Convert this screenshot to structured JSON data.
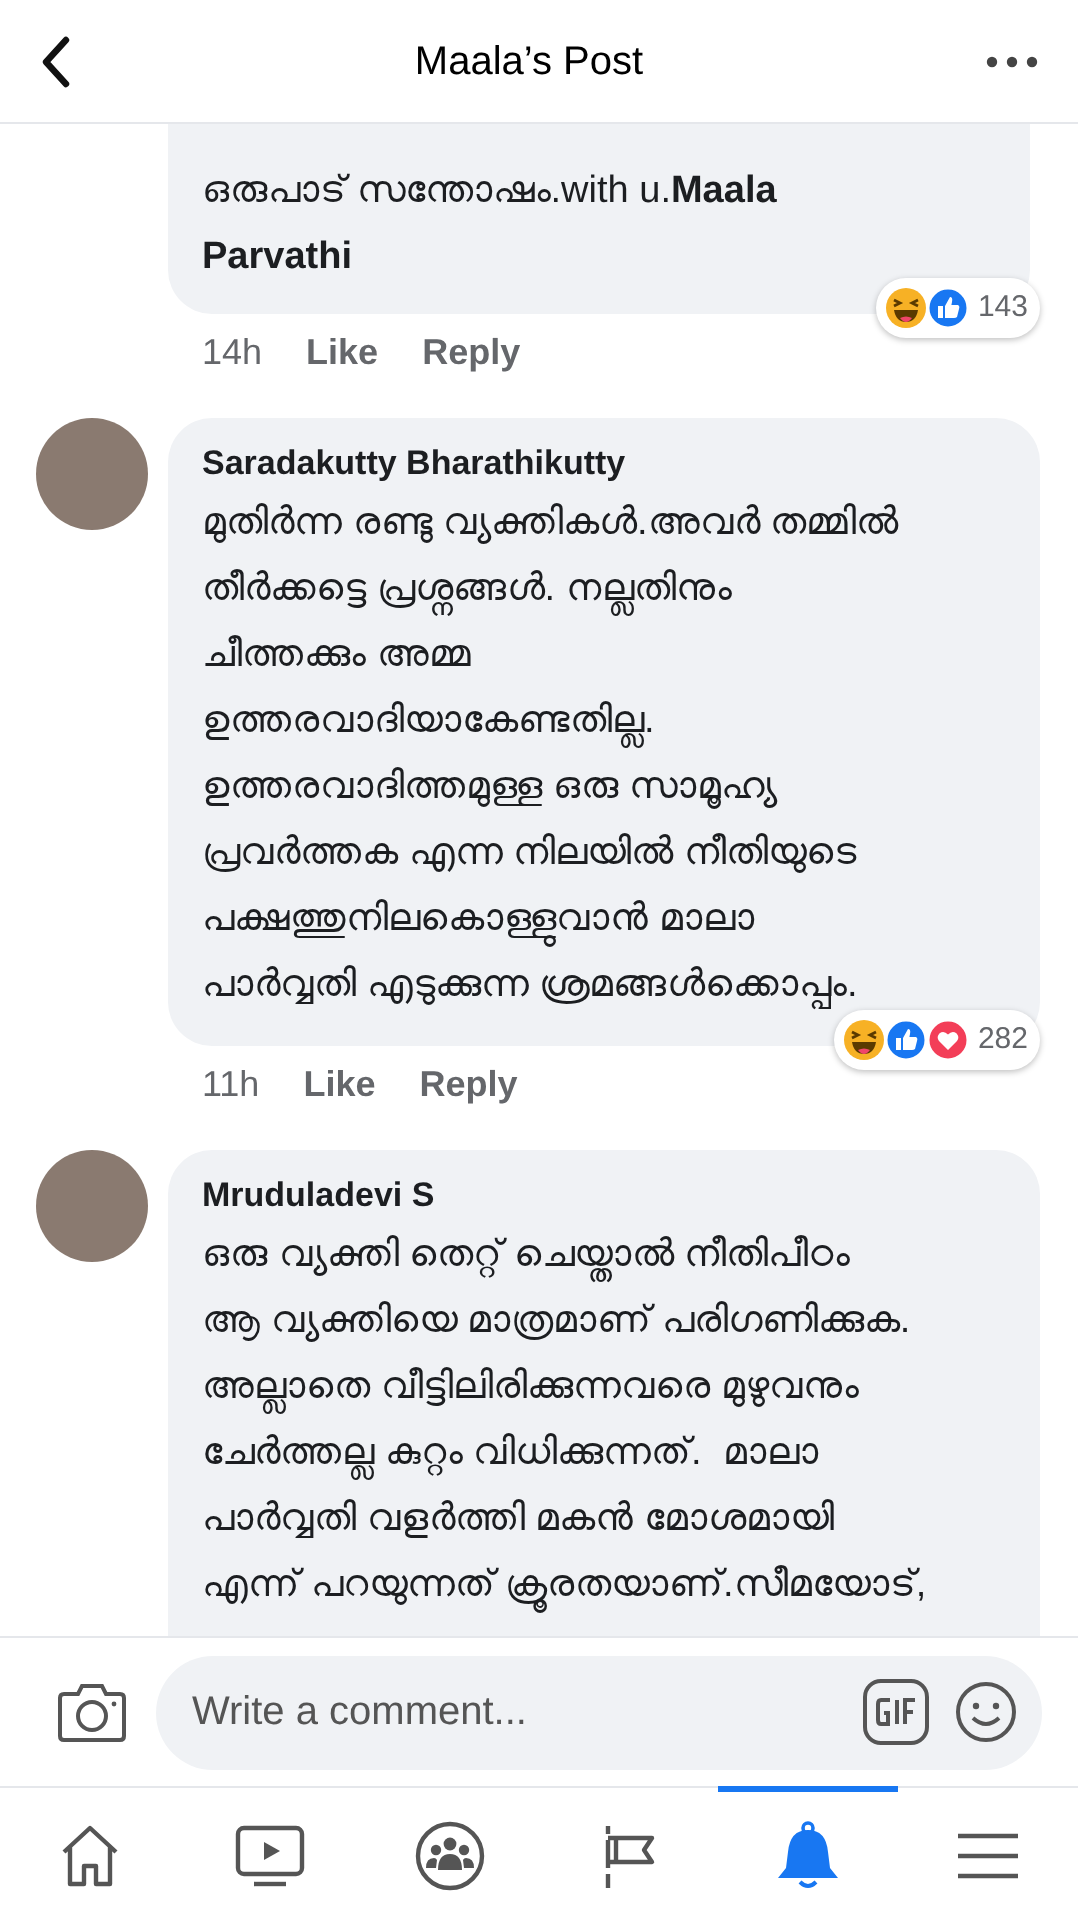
{
  "header": {
    "title": "Maala’s Post"
  },
  "comments": [
    {
      "lines": [
        "ഒരുപാട് സന്തോഷം.with u.**Maala**",
        "**Parvathi**"
      ],
      "time": "14h",
      "actions": [
        "Like",
        "Reply"
      ],
      "reactions": [
        {
          "kind": "haha"
        },
        {
          "kind": "like"
        }
      ],
      "reaction_count": "143"
    },
    {
      "author": "Saradakutty Bharathikutty",
      "lines": [
        "മുതിർന്ന രണ്ടു വ്യക്തികൾ.അവർ തമ്മിൽ",
        "തീർക്കട്ടെ പ്രശ്നങ്ങൾ. നല്ലതിനും",
        "ചീത്തക്കും അമ്മ",
        "ഉത്തരവാദിയാകേണ്ടതില്ല.",
        "ഉത്തരവാദിത്തമുള്ള ഒരു സാമൂഹ്യ",
        "പ്രവർത്തക എന്ന നിലയിൽ നീതിയുടെ",
        "പക്ഷത്തുനിലകൊള്ളുവാൻ മാലാ",
        "പാർവ്വതി എടുക്കുന്ന ശ്രമങ്ങൾക്കൊപ്പം."
      ],
      "time": "11h",
      "actions": [
        "Like",
        "Reply"
      ],
      "reactions": [
        {
          "kind": "haha"
        },
        {
          "kind": "like"
        },
        {
          "kind": "love"
        }
      ],
      "reaction_count": "282"
    },
    {
      "author": "Mruduladevi S",
      "lines": [
        "ഒരു വ്യക്തി തെറ്റ് ചെയ്താൽ നീതിപീഠം",
        "ആ വ്യക്തിയെ മാത്രമാണ് പരിഗണിക്കുക.",
        "അല്ലാതെ വീട്ടിലിരിക്കുന്നവരെ മുഴുവനും",
        "ചേർത്തല്ല കുറ്റം വിധിക്കുന്നത്.  മാലാ",
        "പാർവ്വതി വളർത്തി മകൻ മോശമായി",
        "എന്ന് പറയുന്നത് ക്രൂരതയാണ്.സീമയോട്,"
      ]
    }
  ],
  "composer": {
    "placeholder": "Write a comment..."
  },
  "tabs": [
    {
      "kind": "home",
      "selected": false
    },
    {
      "kind": "video",
      "selected": false
    },
    {
      "kind": "groups",
      "selected": false
    },
    {
      "kind": "pages",
      "selected": false
    },
    {
      "kind": "notifications",
      "selected": true
    },
    {
      "kind": "menu",
      "selected": false
    }
  ]
}
